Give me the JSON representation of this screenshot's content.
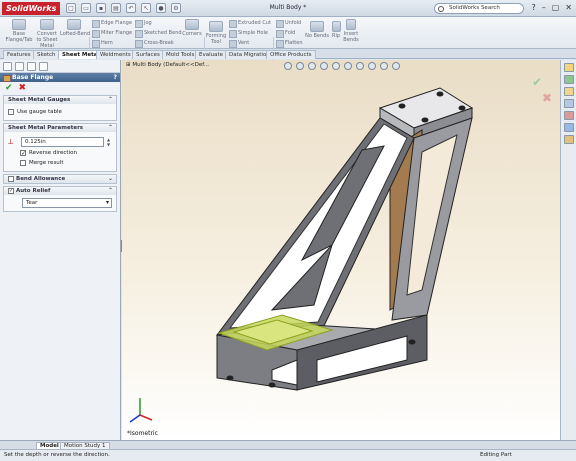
{
  "app": {
    "logo": "SolidWorks",
    "document_title": "Multi Body *",
    "search_placeholder": "SolidWorks Search"
  },
  "window_buttons": [
    "?",
    "–",
    "▢",
    "✕"
  ],
  "ribbon": {
    "big": [
      {
        "name": "base-flange-tab-button",
        "label": "Base\nFlange/Tab"
      },
      {
        "name": "convert-to-sheet-metal-button",
        "label": "Convert\nto Sheet\nMetal"
      },
      {
        "name": "lofted-bend-button",
        "label": "Lofted-Bend"
      },
      {
        "name": "corners-button",
        "label": "Corners"
      },
      {
        "name": "forming-tool-button",
        "label": "Forming\nTool"
      },
      {
        "name": "no-bends-button",
        "label": "No Bends"
      },
      {
        "name": "rip-button",
        "label": "Rip"
      },
      {
        "name": "insert-bends-button",
        "label": "Insert\nBends"
      }
    ],
    "small": [
      {
        "name": "edge-flange-button",
        "label": "Edge Flange"
      },
      {
        "name": "miter-flange-button",
        "label": "Miter Flange"
      },
      {
        "name": "hem-button",
        "label": "Hem"
      },
      {
        "name": "jog-button",
        "label": "Jog"
      },
      {
        "name": "sketched-bend-button",
        "label": "Sketched Bend"
      },
      {
        "name": "cross-break-button",
        "label": "Cross-Break"
      },
      {
        "name": "extruded-cut-button",
        "label": "Extruded Cut"
      },
      {
        "name": "simple-hole-button",
        "label": "Simple Hole"
      },
      {
        "name": "vent-button",
        "label": "Vent"
      },
      {
        "name": "unfold-button",
        "label": "Unfold"
      },
      {
        "name": "fold-button",
        "label": "Fold"
      },
      {
        "name": "flatten-button",
        "label": "Flatten"
      }
    ]
  },
  "tabs": [
    "Features",
    "Sketch",
    "Sheet Metal",
    "Weldments",
    "Surfaces",
    "Mold Tools",
    "Evaluate",
    "Data Migration",
    "Office Products"
  ],
  "active_tab": "Sheet Metal",
  "panel": {
    "title": "Base Flange",
    "help": "?",
    "ok": "✔",
    "cancel": "✖",
    "gauges": {
      "header": "Sheet Metal Gauges",
      "use_gauge": "Use gauge table"
    },
    "params": {
      "header": "Sheet Metal Parameters",
      "thickness": "0.125in",
      "reverse": "Reverse direction",
      "merge": "Merge result"
    },
    "bend_allowance": "Bend Allowance",
    "auto_relief": {
      "header": "Auto Relief",
      "value": "Tear"
    }
  },
  "viewport": {
    "tree_label": "Multi Body  (Default<<Def...",
    "view_label": "*Isometric"
  },
  "bottom_tabs": [
    "Model",
    "Motion Study 1"
  ],
  "status": {
    "message": "Set the depth or reverse the direction.",
    "mode": "Editing Part"
  },
  "colors": {
    "accent": "#3f628b",
    "ok": "#2e9b2e",
    "cancel": "#cc2222",
    "highlight": "#c7d85a"
  }
}
